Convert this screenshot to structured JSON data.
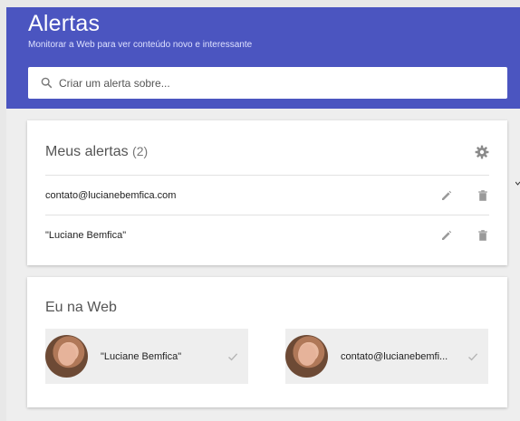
{
  "header": {
    "title": "Alertas",
    "subtitle": "Monitorar a Web para ver conteúdo novo e interessante",
    "search_placeholder": "Criar um alerta sobre...",
    "background_color": "#4b55c0"
  },
  "alerts_card": {
    "title": "Meus alertas",
    "count": "(2)",
    "settings_icon": "gear-icon",
    "items": [
      {
        "label": "contato@lucianebemfica.com",
        "edit_icon": "pencil-icon",
        "delete_icon": "trash-icon"
      },
      {
        "label": "\"Luciane Bemfica\"",
        "edit_icon": "pencil-icon",
        "delete_icon": "trash-icon"
      }
    ]
  },
  "web_card": {
    "title": "Eu na Web",
    "items": [
      {
        "label": "\"Luciane Bemfica\"",
        "status_icon": "check-icon"
      },
      {
        "label": "contato@lucianebemfi...",
        "status_icon": "check-icon"
      }
    ]
  }
}
